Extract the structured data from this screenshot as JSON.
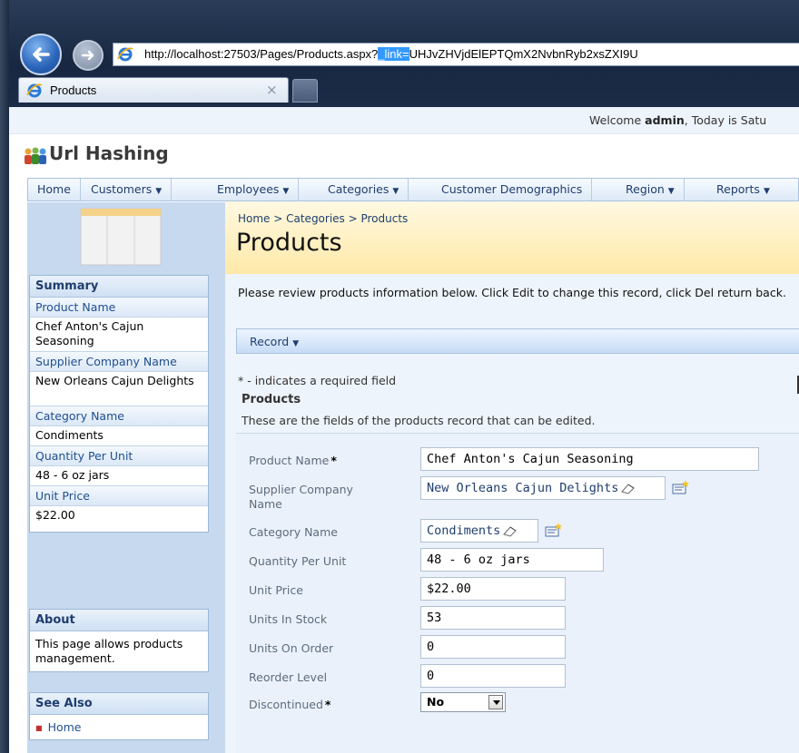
{
  "browser": {
    "url_prefix": "http://localhost:27503/Pages/Products.aspx?",
    "url_selected": "_link=",
    "url_suffix": "UHJvZHVjdElEPTQmX2NvbnRyb2xsZXI9U",
    "tab_title": "Products",
    "tab_close": "×"
  },
  "header": {
    "welcome_prefix": "Welcome ",
    "welcome_user": "admin",
    "welcome_suffix": ", Today is Satu",
    "app_title": "Url Hashing"
  },
  "menu": [
    {
      "label": "Home",
      "dropdown": false
    },
    {
      "label": "Customers",
      "dropdown": true
    },
    {
      "label": "Employees",
      "dropdown": true
    },
    {
      "label": "Categories",
      "dropdown": true
    },
    {
      "label": "Customer Demographics",
      "dropdown": false
    },
    {
      "label": "Region",
      "dropdown": true
    },
    {
      "label": "Reports",
      "dropdown": true
    }
  ],
  "sidebar": {
    "summary_title": "Summary",
    "fields": [
      {
        "label": "Product Name",
        "value": "Chef Anton's Cajun Seasoning"
      },
      {
        "label": "Supplier Company Name",
        "value": "New Orleans Cajun Delights"
      },
      {
        "label": "Category Name",
        "value": "Condiments"
      },
      {
        "label": "Quantity Per Unit",
        "value": "48 - 6 oz jars"
      },
      {
        "label": "Unit Price",
        "value": "$22.00"
      }
    ],
    "about_title": "About",
    "about_text": "This page allows products management.",
    "see_also_title": "See Also",
    "see_also_links": [
      "Home"
    ]
  },
  "main": {
    "breadcrumb": "Home > Categories > Products",
    "title": "Products",
    "intro": "Please review products information below. Click Edit to change this record, click Del return back.",
    "record_button": "Record",
    "required_note": "* - indicates a required field",
    "section_title": "Products",
    "section_desc": "These are the fields of the products record that can be edited."
  },
  "form": {
    "product_name": {
      "label": "Product Name",
      "required": "*",
      "value": "Chef Anton's Cajun Seasoning"
    },
    "supplier": {
      "label_line1": "Supplier Company",
      "label_line2": "Name",
      "value": "New Orleans Cajun Delights"
    },
    "category": {
      "label": "Category Name",
      "value": "Condiments"
    },
    "quantity": {
      "label": "Quantity Per Unit",
      "value": "48 - 6 oz jars"
    },
    "unit_price": {
      "label": "Unit Price",
      "value": "$22.00"
    },
    "units_in_stock": {
      "label": "Units In Stock",
      "value": "53"
    },
    "units_on_order": {
      "label": "Units On Order",
      "value": "0"
    },
    "reorder_level": {
      "label": "Reorder Level",
      "value": "0"
    },
    "discontinued": {
      "label": "Discontinued",
      "required": "*",
      "value": "No"
    }
  },
  "colors": {
    "accent": "#1f3e6e",
    "title_band": "#ffe9a8",
    "url_selection": "#3399ff"
  }
}
